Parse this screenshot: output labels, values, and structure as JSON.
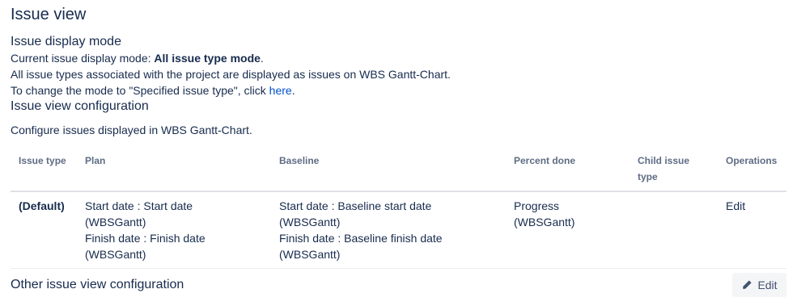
{
  "page": {
    "title": "Issue view"
  },
  "display_mode": {
    "heading": "Issue display mode",
    "current_prefix": "Current issue display mode: ",
    "current_value": "All issue type mode",
    "current_suffix": ".",
    "description": "All issue types associated with the project are displayed as issues on WBS Gantt-Chart.",
    "change_prefix": "To change the mode to \"Specified issue type\", click ",
    "change_link": "here",
    "change_suffix": "."
  },
  "view_config": {
    "heading": "Issue view configuration",
    "description": "Configure issues displayed in WBS Gantt-Chart.",
    "table": {
      "headers": {
        "issue_type": "Issue type",
        "plan": "Plan",
        "baseline": "Baseline",
        "percent_done": "Percent done",
        "child_issue_type": "Child issue type",
        "operations": "Operations"
      },
      "rows": [
        {
          "issue_type": "(Default)",
          "plan_start": "Start date : Start date (WBSGantt)",
          "plan_finish": "Finish date : Finish date (WBSGantt)",
          "baseline_start": "Start date : Baseline start date (WBSGantt)",
          "baseline_finish": "Finish date : Baseline finish date (WBSGantt)",
          "percent_done": "Progress (WBSGantt)",
          "child_issue_type": "",
          "operation": "Edit"
        }
      ]
    }
  },
  "other_config": {
    "heading": "Other issue view configuration",
    "edit_label": "Edit",
    "edit_icon": "pencil-icon"
  },
  "colors": {
    "text": "#172b4d",
    "header_text": "#5e6c84",
    "link": "#0052cc",
    "button_bg": "#f4f5f7",
    "divider": "#dfe1e6"
  }
}
